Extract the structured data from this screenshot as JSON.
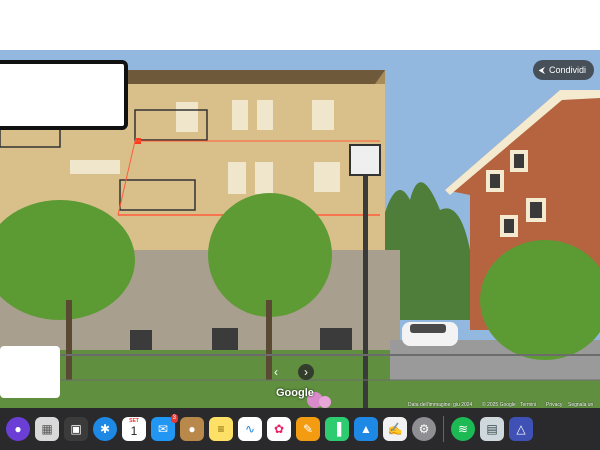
{
  "topbar": {},
  "viewer": {
    "share_label": "Condividi",
    "share_icon": "share-icon",
    "google_logo": "Google",
    "footer_items": [
      "Data dell'immagine: giu 2024",
      "© 2025 Google",
      "Termini",
      "Privacy",
      "Segnala un problema"
    ]
  },
  "dock": {
    "items": [
      {
        "name": "siri",
        "icon": "siri-icon",
        "color": "#6b3fd6"
      },
      {
        "name": "launchpad",
        "icon": "launchpad-icon",
        "color": "#d9d9d9"
      },
      {
        "name": "mission-control",
        "icon": "mission-control-icon",
        "color": "#3b3b3b"
      },
      {
        "name": "safari",
        "icon": "safari-icon",
        "color": "#1e88e5"
      },
      {
        "name": "calendar",
        "icon": "calendar-icon",
        "color": "#ffffff",
        "month": "SET",
        "day": "1"
      },
      {
        "name": "mail",
        "icon": "mail-icon",
        "color": "#2196f3",
        "badge": "3"
      },
      {
        "name": "notes-brown",
        "icon": "contacts-icon",
        "color": "#b8894a"
      },
      {
        "name": "notes",
        "icon": "notes-icon",
        "color": "#ffe066"
      },
      {
        "name": "freeform",
        "icon": "freeform-icon",
        "color": "#ffffff"
      },
      {
        "name": "photos",
        "icon": "photos-icon",
        "color": "#ffffff"
      },
      {
        "name": "pages",
        "icon": "pages-icon",
        "color": "#f39c12"
      },
      {
        "name": "numbers",
        "icon": "numbers-icon",
        "color": "#2ecc71"
      },
      {
        "name": "keynote",
        "icon": "keynote-icon",
        "color": "#1e88e5"
      },
      {
        "name": "textedit",
        "icon": "textedit-icon",
        "color": "#f1f1f1"
      },
      {
        "name": "settings",
        "icon": "settings-icon",
        "color": "#8e8e93"
      },
      {
        "name": "spotify",
        "icon": "spotify-icon",
        "color": "#1db954"
      },
      {
        "name": "preview",
        "icon": "preview-icon",
        "color": "#cfd8dc"
      },
      {
        "name": "image-capture",
        "icon": "image-capture-icon",
        "color": "#3f51b5"
      }
    ]
  }
}
